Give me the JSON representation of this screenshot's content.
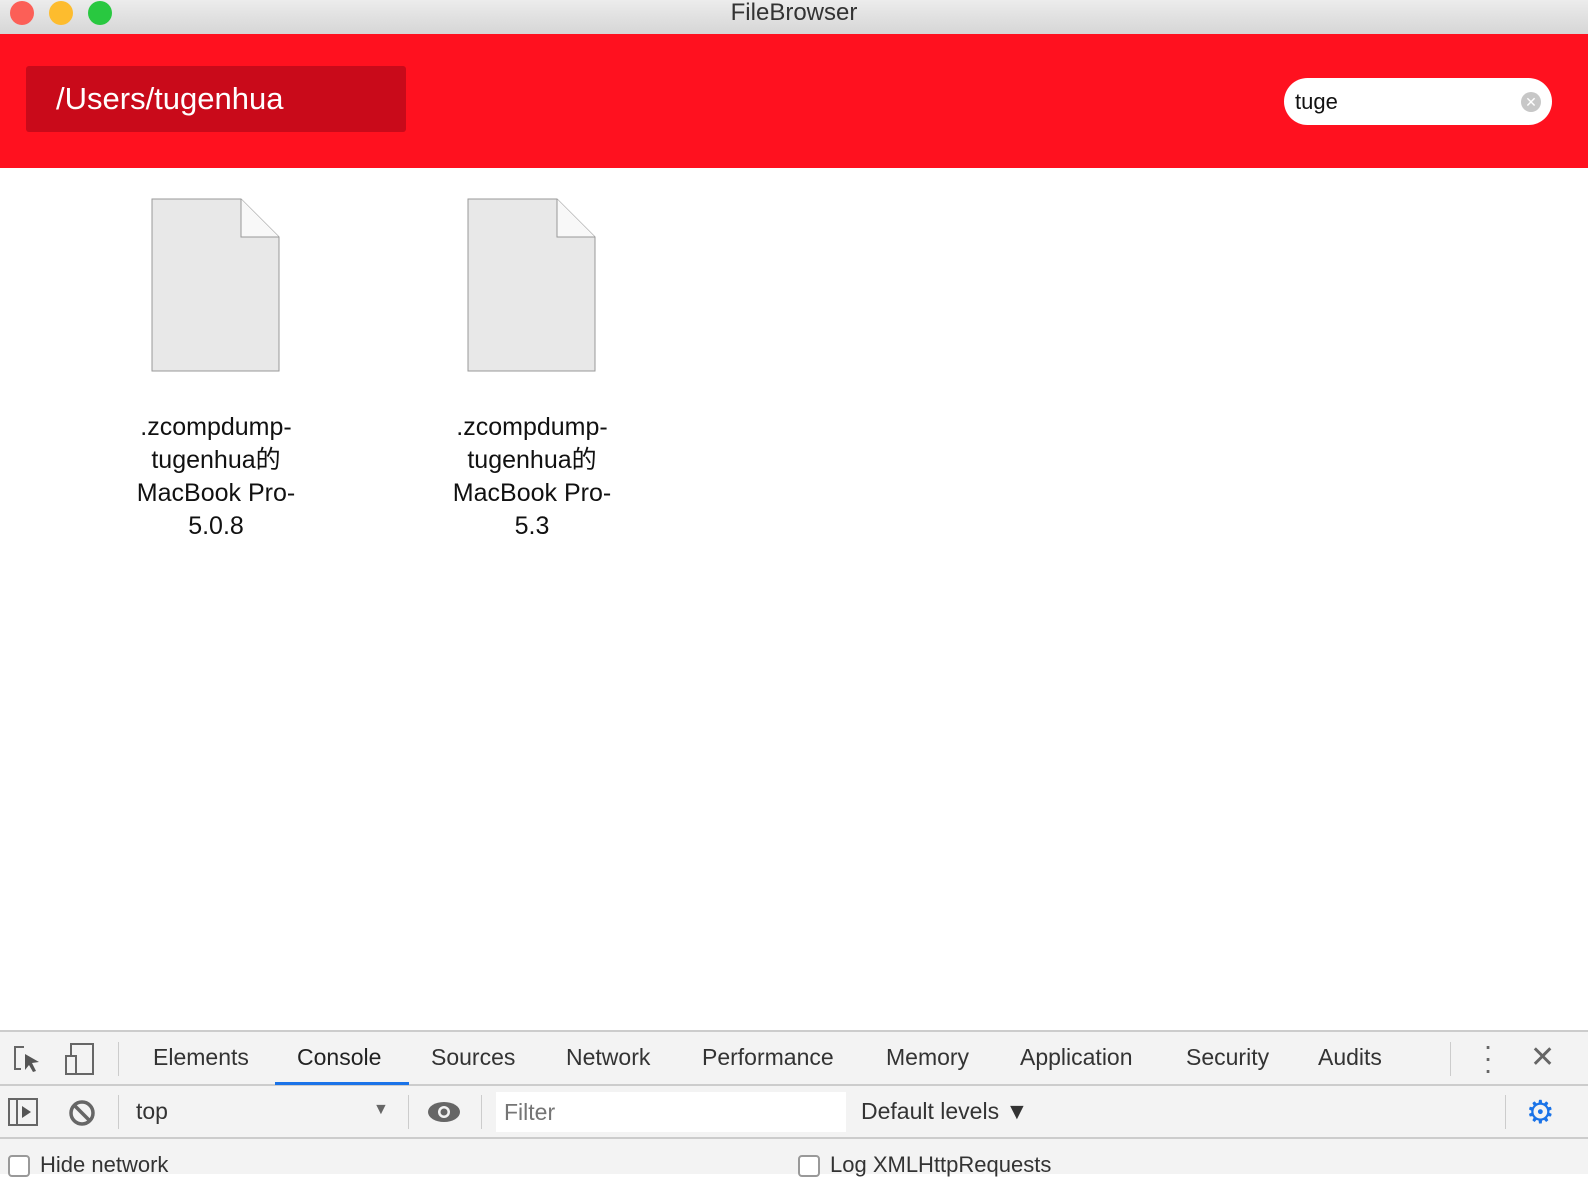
{
  "window": {
    "title": "FileBrowser"
  },
  "header": {
    "path": "/Users/tugenhua",
    "search_value": "tuge",
    "accent": "#ff111f"
  },
  "files": [
    {
      "name_lines": [
        ".zcompdump-",
        "tugenhua的",
        "MacBook Pro-",
        "5.0.8"
      ]
    },
    {
      "name_lines": [
        ".zcompdump-",
        "tugenhua的",
        "MacBook Pro-",
        "5.3"
      ]
    }
  ],
  "devtools": {
    "tabs": [
      "Elements",
      "Console",
      "Sources",
      "Network",
      "Performance",
      "Memory",
      "Application",
      "Security",
      "Audits"
    ],
    "active_tab": "Console",
    "context": "top",
    "filter_placeholder": "Filter",
    "levels": "Default levels ▼",
    "options": [
      "Hide network",
      "Log XMLHttpRequests"
    ]
  }
}
